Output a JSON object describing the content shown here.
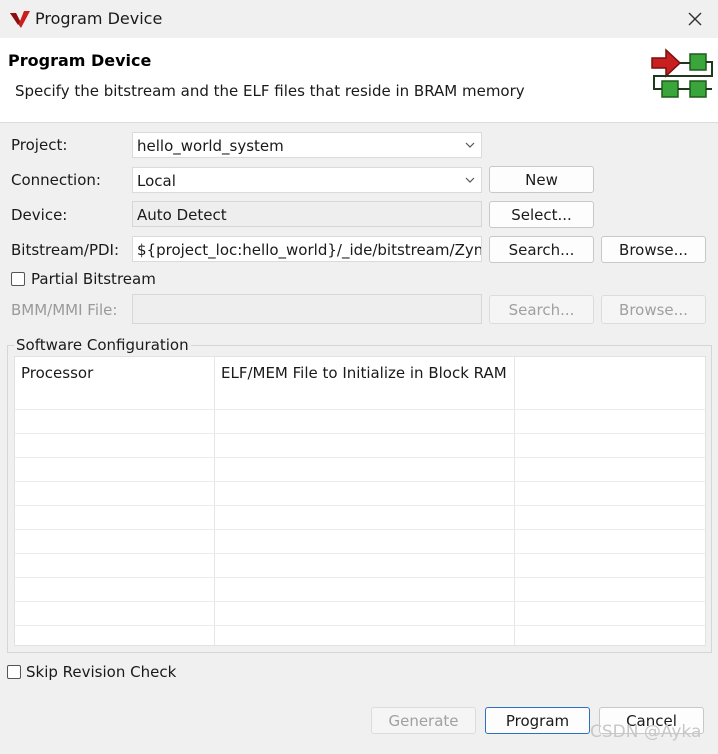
{
  "window": {
    "title": "Program Device",
    "close_icon": "close-icon"
  },
  "banner": {
    "title": "Program Device",
    "description": "Specify the bitstream and the ELF files that reside in BRAM memory"
  },
  "form": {
    "project": {
      "label": "Project:",
      "value": "hello_world_system"
    },
    "connection": {
      "label": "Connection:",
      "value": "Local",
      "new_button": "New"
    },
    "device": {
      "label": "Device:",
      "value": "Auto Detect",
      "select_button": "Select..."
    },
    "bitstream": {
      "label": "Bitstream/PDI:",
      "value": "${project_loc:hello_world}/_ide/bitstream/Zynq",
      "search_button": "Search...",
      "browse_button": "Browse..."
    },
    "partial_bitstream": {
      "label": "Partial Bitstream",
      "checked": false
    },
    "bmm": {
      "label": "BMM/MMI File:",
      "value": "",
      "search_button": "Search...",
      "browse_button": "Browse..."
    }
  },
  "software_config": {
    "title": "Software Configuration",
    "columns": [
      "Processor",
      "ELF/MEM File to Initialize in Block RAM",
      ""
    ],
    "rows": []
  },
  "skip_revision": {
    "label": "Skip Revision Check",
    "checked": false
  },
  "footer": {
    "generate_button": "Generate",
    "program_button": "Program",
    "cancel_button": "Cancel"
  },
  "watermark": "CSDN @Ayka",
  "colors": {
    "accent_border": "#2f6fbf",
    "logo_red": "#c8201e",
    "logo_green": "#3aa53a"
  }
}
